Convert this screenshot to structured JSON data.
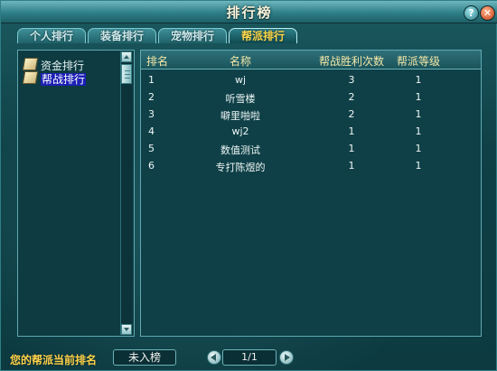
{
  "window": {
    "title": "排行榜"
  },
  "title_buttons": {
    "help": "?",
    "close": "✕"
  },
  "tabs": [
    {
      "label": "个人排行",
      "active": false
    },
    {
      "label": "装备排行",
      "active": false
    },
    {
      "label": "宠物排行",
      "active": false
    },
    {
      "label": "帮派排行",
      "active": true
    }
  ],
  "sidebar": {
    "items": [
      {
        "label": "资金排行",
        "icon": "document-icon",
        "selected": false
      },
      {
        "label": "帮战排行",
        "icon": "document-icon",
        "selected": true
      }
    ]
  },
  "table": {
    "headers": [
      "排名",
      "名称",
      "帮战胜利次数",
      "帮派等级"
    ],
    "rows": [
      {
        "rank": "1",
        "name": "wj",
        "wins": "3",
        "level": "1"
      },
      {
        "rank": "2",
        "name": "听雪楼",
        "wins": "2",
        "level": "1"
      },
      {
        "rank": "3",
        "name": "噼里啪啦",
        "wins": "2",
        "level": "1"
      },
      {
        "rank": "4",
        "name": "wj2",
        "wins": "1",
        "level": "1"
      },
      {
        "rank": "5",
        "name": "数值测试",
        "wins": "1",
        "level": "1"
      },
      {
        "rank": "6",
        "name": "专打陈煜的",
        "wins": "1",
        "level": "1"
      }
    ]
  },
  "footer": {
    "label": "您的帮派当前排名",
    "current_rank": "未入榜",
    "page": "1/1"
  },
  "colors": {
    "accent_gold": "#ffd34a",
    "selection_blue": "#1b1fb4",
    "panel_border": "#5fa9b1"
  }
}
